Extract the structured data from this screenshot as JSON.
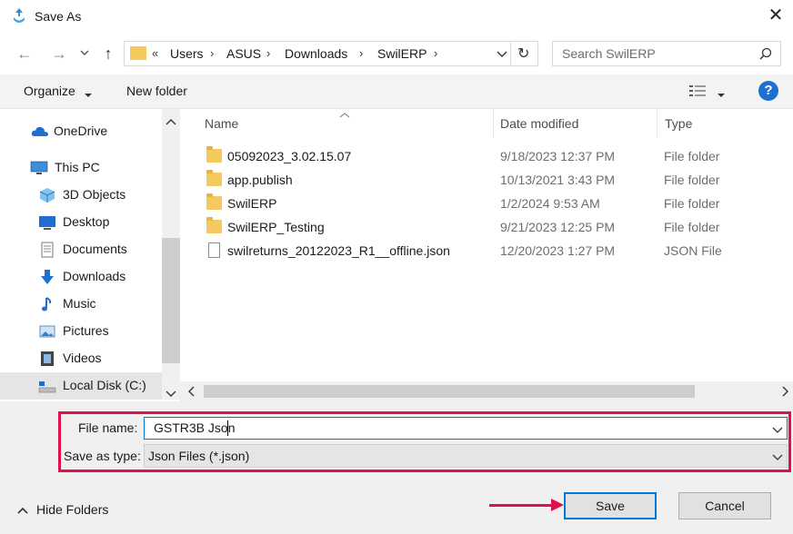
{
  "window": {
    "title": "Save As",
    "close": "✕"
  },
  "nav": {
    "back": "←",
    "forward": "→",
    "dropdown": "⌄",
    "up": "↑",
    "breadcrumb_prefix": "«",
    "breadcrumb": [
      "Users",
      "ASUS",
      "Downloads",
      "SwilERP"
    ],
    "sep": "›",
    "refresh": "↻",
    "search_placeholder": "Search SwilERP"
  },
  "toolbar": {
    "organize": "Organize",
    "new_folder": "New folder",
    "help": "?"
  },
  "sidebar": {
    "items": [
      {
        "label": "OneDrive",
        "icon": "cloud-icon"
      },
      {
        "label": "This PC",
        "icon": "computer-icon"
      },
      {
        "label": "3D Objects",
        "icon": "cube-icon"
      },
      {
        "label": "Desktop",
        "icon": "desktop-icon"
      },
      {
        "label": "Documents",
        "icon": "document-icon"
      },
      {
        "label": "Downloads",
        "icon": "download-icon"
      },
      {
        "label": "Music",
        "icon": "music-icon"
      },
      {
        "label": "Pictures",
        "icon": "picture-icon"
      },
      {
        "label": "Videos",
        "icon": "video-icon"
      },
      {
        "label": "Local Disk (C:)",
        "icon": "drive-icon"
      }
    ]
  },
  "filelist": {
    "columns": [
      "Name",
      "Date modified",
      "Type"
    ],
    "rows": [
      {
        "name": "05092023_3.02.15.07",
        "date": "9/18/2023 12:37 PM",
        "type": "File folder",
        "icon": "folder-icon"
      },
      {
        "name": "app.publish",
        "date": "10/13/2021 3:43 PM",
        "type": "File folder",
        "icon": "folder-icon"
      },
      {
        "name": "SwilERP",
        "date": "1/2/2024 9:53 AM",
        "type": "File folder",
        "icon": "folder-icon"
      },
      {
        "name": "SwilERP_Testing",
        "date": "9/21/2023 12:25 PM",
        "type": "File folder",
        "icon": "folder-icon"
      },
      {
        "name": "swilreturns_20122023_R1__offline.json",
        "date": "12/20/2023 1:27 PM",
        "type": "JSON File",
        "icon": "json-file-icon"
      }
    ]
  },
  "form": {
    "file_name_label": "File name:",
    "file_name_value": "GSTR3B Json",
    "save_as_type_label": "Save as type:",
    "save_as_type_value": "Json Files (*.json)"
  },
  "footer": {
    "hide_folders": "Hide Folders",
    "save": "Save",
    "cancel": "Cancel"
  },
  "colors": {
    "highlight": "#e0104d",
    "accent": "#0078d7"
  }
}
